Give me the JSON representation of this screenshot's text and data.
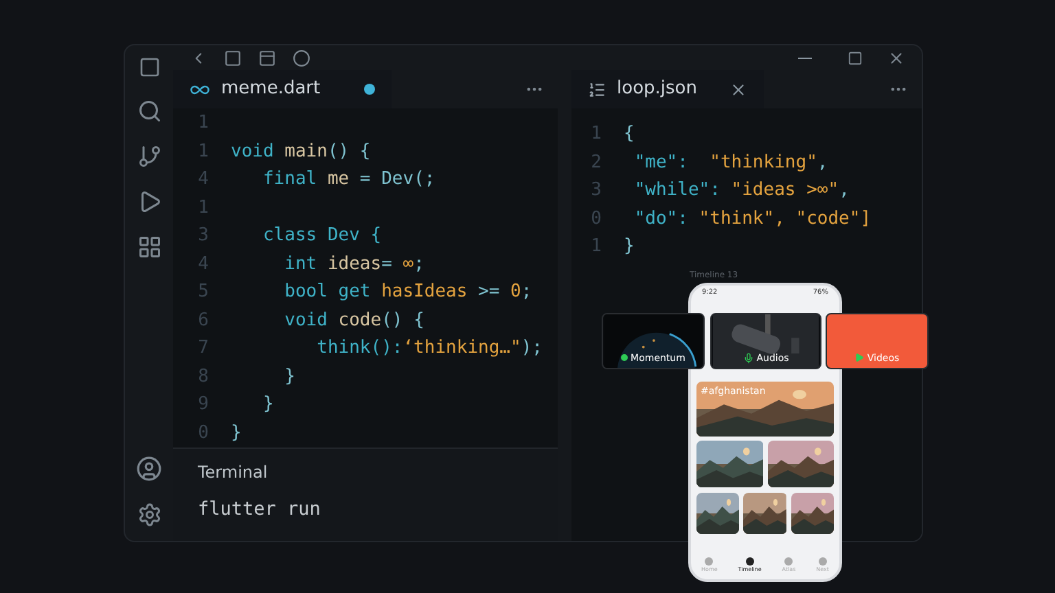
{
  "left_editor": {
    "tab": {
      "label": "meme.dart",
      "modified": true
    },
    "lines": [
      {
        "number": "1"
      },
      {
        "number": "1",
        "tokens": [
          {
            "text": "void ",
            "kind": "kw"
          },
          {
            "text": "main",
            "kind": "name"
          },
          {
            "text": "() {",
            "kind": "punct"
          }
        ]
      },
      {
        "number": "4",
        "tokens": [
          {
            "text": "   final ",
            "kind": "kw"
          },
          {
            "text": "me",
            "kind": "name"
          },
          {
            "text": " = Dev(;",
            "kind": "punct"
          }
        ]
      },
      {
        "number": "1"
      },
      {
        "number": "3",
        "tokens": [
          {
            "text": "   class Dev {",
            "kind": "kw"
          }
        ]
      },
      {
        "number": "4",
        "tokens": [
          {
            "text": "     int ",
            "kind": "kw"
          },
          {
            "text": "ideas",
            "kind": "name"
          },
          {
            "text": "= ",
            "kind": "punct"
          },
          {
            "text": "∞",
            "kind": "str"
          },
          {
            "text": ";",
            "kind": "punct"
          }
        ]
      },
      {
        "number": "5",
        "tokens": [
          {
            "text": "     bool get ",
            "kind": "kw"
          },
          {
            "text": "hasIdeas",
            "kind": "str"
          },
          {
            "text": " >= ",
            "kind": "punct"
          },
          {
            "text": "0",
            "kind": "str"
          },
          {
            "text": ";",
            "kind": "punct"
          }
        ]
      },
      {
        "number": "6",
        "tokens": [
          {
            "text": "     void ",
            "kind": "kw"
          },
          {
            "text": "code",
            "kind": "name"
          },
          {
            "text": "() {",
            "kind": "punct"
          }
        ]
      },
      {
        "number": "7",
        "tokens": [
          {
            "text": "        think():",
            "kind": "kw"
          },
          {
            "text": "‘thinking…\"",
            "kind": "str"
          },
          {
            "text": ");",
            "kind": "punct"
          }
        ]
      },
      {
        "number": "8",
        "tokens": [
          {
            "text": "     }",
            "kind": "punct"
          }
        ]
      },
      {
        "number": "9",
        "tokens": [
          {
            "text": "   }",
            "kind": "punct"
          }
        ]
      },
      {
        "number": "0",
        "tokens": [
          {
            "text": "}",
            "kind": "punct"
          }
        ]
      }
    ]
  },
  "right_editor": {
    "tab": {
      "label": "loop.json",
      "modified": false
    },
    "lines": [
      {
        "number": "1",
        "tokens": [
          {
            "text": "{",
            "kind": "punct"
          }
        ]
      },
      {
        "number": "2",
        "tokens": [
          {
            "text": " \"me\": ",
            "kind": "kw"
          },
          {
            "text": " \"thinking\"",
            "kind": "str"
          },
          {
            "text": ",",
            "kind": "punct"
          }
        ]
      },
      {
        "number": "3",
        "tokens": [
          {
            "text": " \"while\": ",
            "kind": "kw"
          },
          {
            "text": "\"ideas >∞\"",
            "kind": "str"
          },
          {
            "text": ",",
            "kind": "punct"
          }
        ]
      },
      {
        "number": "0",
        "tokens": [
          {
            "text": " \"do\": ",
            "kind": "kw"
          },
          {
            "text": "\"think\", \"code\"]",
            "kind": "str"
          }
        ]
      },
      {
        "number": "1",
        "tokens": [
          {
            "text": "}",
            "kind": "punct"
          }
        ]
      }
    ]
  },
  "terminal": {
    "title": "Terminal",
    "command": "flutter run"
  },
  "phone": {
    "caption": "Timeline 13",
    "time": "9:22",
    "battery": "76%",
    "hashtag": "#afghanistan",
    "cards": [
      {
        "label": "Momentum",
        "kind": "dot"
      },
      {
        "label": "Audios",
        "kind": "mic"
      },
      {
        "label": "Videos",
        "kind": "play"
      }
    ],
    "nav": [
      {
        "label": "Home",
        "selected": false
      },
      {
        "label": "Timeline",
        "selected": true
      },
      {
        "label": "Atlas",
        "selected": false
      },
      {
        "label": "Next",
        "selected": false
      }
    ]
  }
}
